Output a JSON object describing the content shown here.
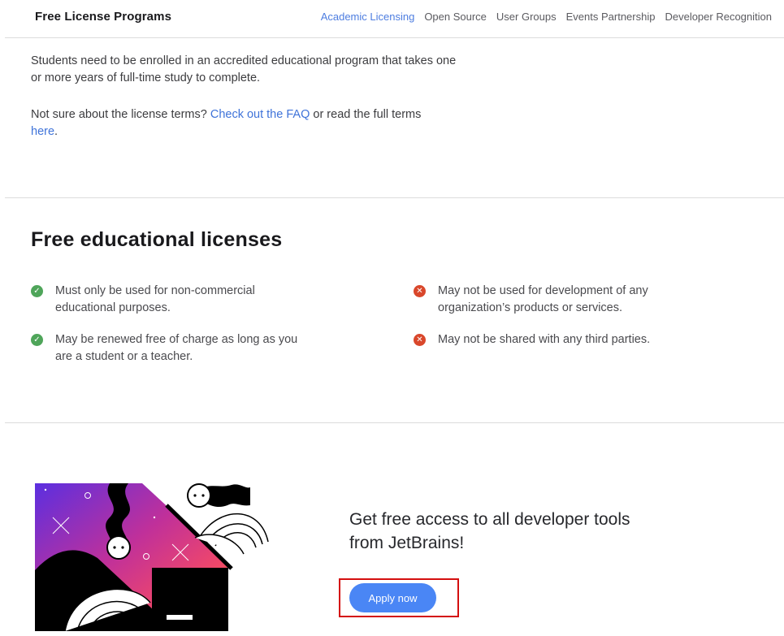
{
  "header": {
    "brand": "Free License Programs",
    "nav": [
      {
        "label": "Academic Licensing",
        "active": true
      },
      {
        "label": "Open Source",
        "active": false
      },
      {
        "label": "User Groups",
        "active": false
      },
      {
        "label": "Events Partnership",
        "active": false
      },
      {
        "label": "Developer Recognition",
        "active": false
      }
    ]
  },
  "intro": {
    "enrollment_text": "Students need to be enrolled in an accredited educational program that takes one or more years of full-time study to complete.",
    "terms_prefix": "Not sure about the license terms? ",
    "faq_link": "Check out the FAQ",
    "terms_middle": " or read the full terms ",
    "here_link": "here",
    "terms_suffix": "."
  },
  "licenses": {
    "title": "Free educational licenses",
    "allowed": [
      "Must only be used for non-commercial educational purposes.",
      "May be renewed free of charge as long as you are a student or a teacher."
    ],
    "disallowed": [
      "May not be used for development of any organization’s products or services.",
      "May not be shared with any third parties."
    ],
    "allowed_icon": "check-circle-icon",
    "disallowed_icon": "cross-circle-icon",
    "allowed_color": "#4fa55a",
    "disallowed_color": "#d9472b"
  },
  "cta": {
    "title": "Get free access to all developer tools from JetBrains!",
    "button": "Apply now",
    "button_color": "#4a86f5",
    "highlight_color": "#d40f0f"
  },
  "colors": {
    "nav_active": "#4d7de0",
    "link": "#3f73d9"
  }
}
